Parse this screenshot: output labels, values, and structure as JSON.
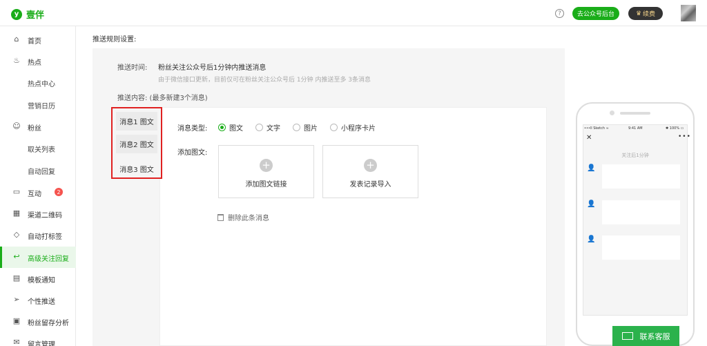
{
  "brand": {
    "logo_glyph": "y",
    "name": "壹伴",
    "color": "#1aad19"
  },
  "header": {
    "help_glyph": "?",
    "mp_button": "去公众号后台",
    "renew_icon": "crown-icon",
    "renew_button": "续费"
  },
  "sidebar": {
    "items": [
      {
        "label": "首页",
        "icon": "home-icon",
        "glyph": "⌂",
        "type": "main"
      },
      {
        "label": "热点",
        "icon": "fire-icon",
        "glyph": "♨",
        "type": "main"
      },
      {
        "label": "热点中心",
        "type": "sub"
      },
      {
        "label": "营销日历",
        "type": "sub"
      },
      {
        "label": "粉丝",
        "icon": "user-icon",
        "glyph": "☺",
        "type": "main"
      },
      {
        "label": "取关列表",
        "type": "sub"
      },
      {
        "label": "自动回复",
        "type": "sub"
      },
      {
        "label": "互动",
        "icon": "chat-icon",
        "glyph": "▭",
        "type": "main",
        "badge": "2"
      },
      {
        "label": "渠道二维码",
        "icon": "qrcode-icon",
        "glyph": "▦",
        "type": "main"
      },
      {
        "label": "自动打标签",
        "icon": "tag-icon",
        "glyph": "◇",
        "type": "main"
      },
      {
        "label": "高级关注回复",
        "icon": "reply-icon",
        "glyph": "↩",
        "type": "main",
        "active": true
      },
      {
        "label": "模板通知",
        "icon": "template-icon",
        "glyph": "▤",
        "type": "main"
      },
      {
        "label": "个性推送",
        "icon": "send-icon",
        "glyph": "➢",
        "type": "main"
      },
      {
        "label": "粉丝留存分析",
        "icon": "chart-icon",
        "glyph": "▣",
        "type": "main"
      },
      {
        "label": "留言管理",
        "icon": "message-icon",
        "glyph": "✉",
        "type": "main"
      }
    ]
  },
  "main": {
    "section_title": "推送规则设置:",
    "push_time_label": "推送时间:",
    "push_time_value": "粉丝关注公众号后1分钟内推送消息",
    "push_time_note": "由于微信接口更新，目前仅可在粉丝关注公众号后 1分钟 内推送至多 3条消息",
    "push_content_label": "推送内容:  (最多新建3个消息)",
    "message_tabs": [
      "消息1 图文",
      "消息2 图文",
      "消息3 图文"
    ],
    "message_type_label": "消息类型:",
    "message_types": [
      {
        "label": "图文",
        "checked": true
      },
      {
        "label": "文字",
        "checked": false
      },
      {
        "label": "图片",
        "checked": false
      },
      {
        "label": "小程序卡片",
        "checked": false
      }
    ],
    "add_content_label": "添加图文:",
    "add_link_button": "添加图文链接",
    "import_button": "发表记录导入",
    "plus_glyph": "+",
    "delete_label": "删除此条消息"
  },
  "phone": {
    "status_left": "•••ll Sketch ≈",
    "status_time": "9:41 AM",
    "status_right": "✱ 100% ▭",
    "close_glyph": "✕",
    "more_glyph": "•••",
    "caption": "关注后1分钟",
    "avatar_glyph": "👤"
  },
  "service_button": "联系客服"
}
